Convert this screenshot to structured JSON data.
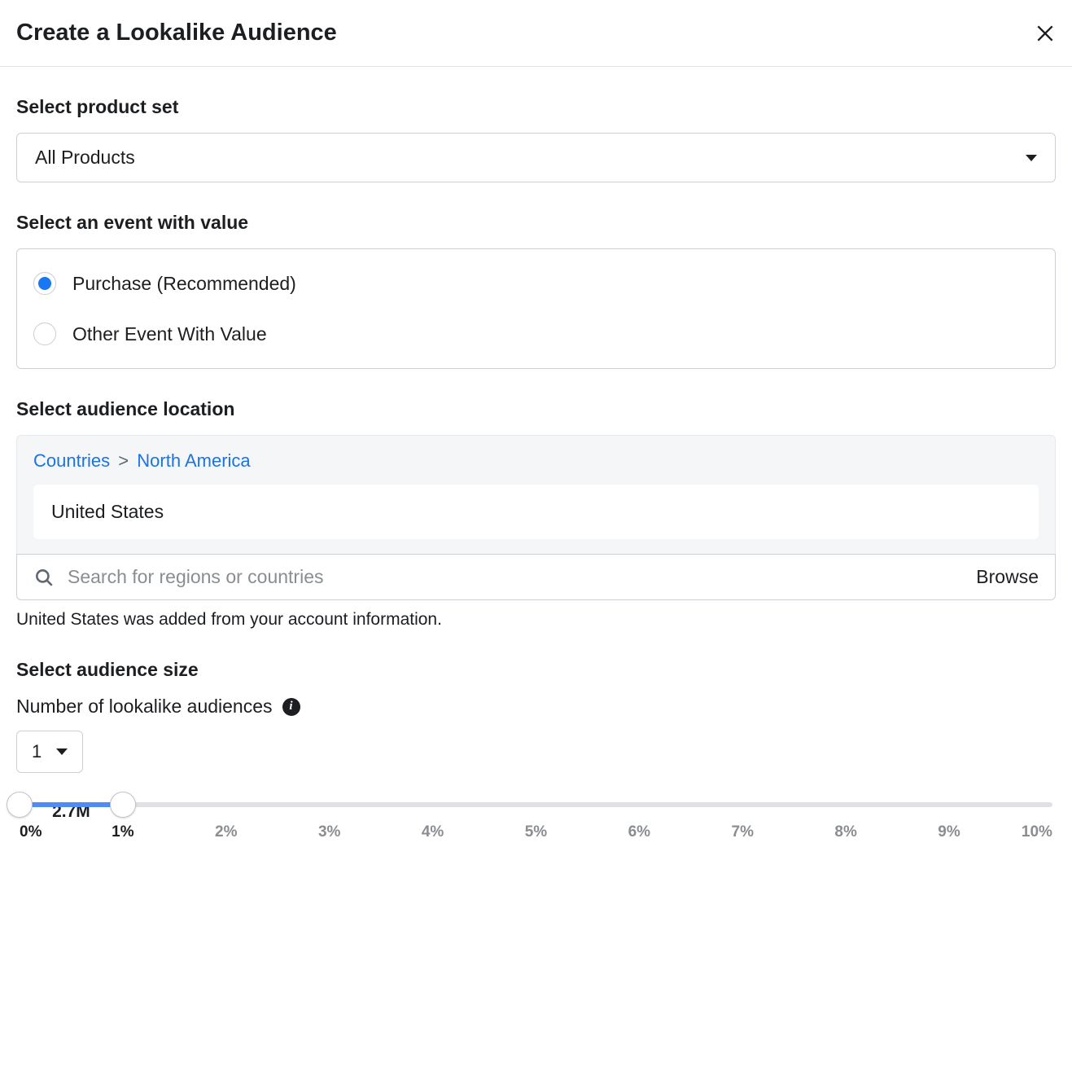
{
  "dialog": {
    "title": "Create a Lookalike Audience"
  },
  "productSet": {
    "label": "Select product set",
    "selected": "All Products"
  },
  "event": {
    "label": "Select an event with value",
    "options": [
      {
        "label": "Purchase (Recommended)",
        "selected": true
      },
      {
        "label": "Other Event With Value",
        "selected": false
      }
    ]
  },
  "location": {
    "label": "Select audience location",
    "breadcrumb": {
      "root": "Countries",
      "separator": ">",
      "leaf": "North America"
    },
    "selected_location": "United States",
    "search_placeholder": "Search for regions or countries",
    "browse_label": "Browse",
    "helper": "United States was added from your account information."
  },
  "size": {
    "label": "Select audience size",
    "sublabel": "Number of lookalike audiences",
    "count": "1",
    "estimated": "2.7M",
    "slider": {
      "min_pct": 0,
      "max_pct": 10,
      "low_pct": 0,
      "high_pct": 1,
      "ticks": [
        "0%",
        "1%",
        "2%",
        "3%",
        "4%",
        "5%",
        "6%",
        "7%",
        "8%",
        "9%",
        "10%"
      ]
    }
  }
}
